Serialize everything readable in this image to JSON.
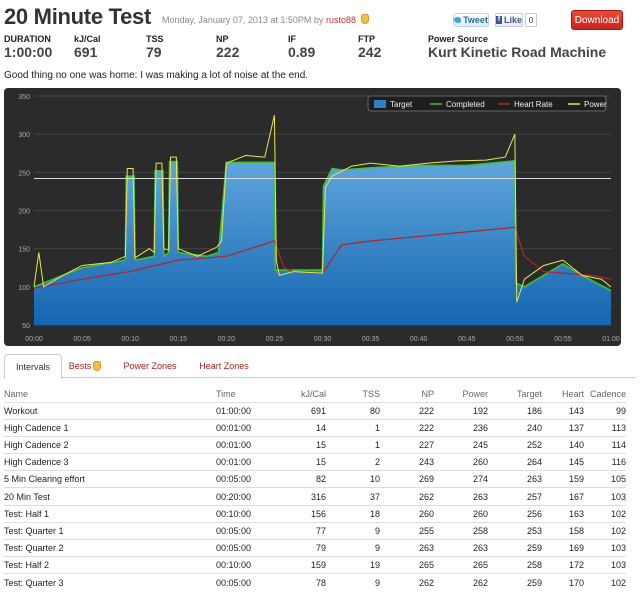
{
  "header": {
    "title": "20 Minute Test",
    "date": "Monday, January 07, 2013 at 1:50PM by",
    "user": "rusto88",
    "tweet_label": "Tweet",
    "like_label": "Like",
    "like_count": "0",
    "download_label": "Download"
  },
  "stats": [
    {
      "label": "DURATION",
      "value": "1:00:00"
    },
    {
      "label": "kJ/Cal",
      "value": "691"
    },
    {
      "label": "TSS",
      "value": "79"
    },
    {
      "label": "NP",
      "value": "222"
    },
    {
      "label": "IF",
      "value": "0.89"
    },
    {
      "label": "FTP",
      "value": "242"
    },
    {
      "label": "Power Source",
      "value": "Kurt Kinetic Road Machine"
    }
  ],
  "description": "Good thing no one was home: I was making a lot of noise at the end.",
  "chart_data": {
    "type": "area",
    "ylim": [
      50,
      350
    ],
    "y_ticks": [
      50,
      100,
      150,
      200,
      250,
      300,
      350
    ],
    "x_ticks": [
      "00:00",
      "00:05",
      "00:10",
      "00:15",
      "00:20",
      "00:25",
      "00:30",
      "00:35",
      "00:40",
      "00:45",
      "00:50",
      "00:55",
      "01:00"
    ],
    "xlim_minutes": [
      0,
      60
    ],
    "ftp_line": 242,
    "legend": [
      "Target",
      "Completed",
      "Heart Rate",
      "Power"
    ],
    "colors": {
      "target": "#2f7fc6",
      "completed": "#3dbf3d",
      "heart_rate": "#b02525",
      "power": "#e8e84a"
    },
    "series": [
      {
        "name": "Target",
        "x": [
          0,
          5,
          9.5,
          9.6,
          10.4,
          10.5,
          12.5,
          12.6,
          13.4,
          13.5,
          14,
          14.1,
          14.9,
          15,
          18,
          19.2,
          20,
          25,
          25.1,
          30,
          30.1,
          31,
          32,
          35,
          40,
          45,
          50,
          50.1,
          51,
          55,
          57,
          60
        ],
        "values": [
          100,
          125,
          135,
          245,
          245,
          135,
          140,
          252,
          252,
          140,
          145,
          264,
          264,
          145,
          140,
          145,
          263,
          263,
          122,
          122,
          232,
          255,
          253,
          256,
          259,
          259,
          265,
          105,
          100,
          130,
          115,
          95
        ]
      },
      {
        "name": "Heart Rate",
        "x": [
          0,
          5,
          10,
          15,
          18,
          20,
          22,
          25,
          26,
          27,
          30,
          32,
          35,
          40,
          45,
          50,
          51,
          53,
          55,
          58,
          60
        ],
        "values": [
          98,
          110,
          120,
          135,
          138,
          140,
          148,
          160,
          125,
          120,
          118,
          155,
          160,
          166,
          172,
          178,
          140,
          120,
          118,
          115,
          110
        ]
      },
      {
        "name": "Power",
        "x": [
          0,
          0.5,
          1,
          3,
          5,
          8,
          9.5,
          9.7,
          10.3,
          10.5,
          12,
          12.5,
          12.7,
          13.3,
          13.5,
          14,
          14.2,
          14.8,
          15,
          17,
          19,
          19.5,
          20,
          22,
          24,
          25,
          25.2,
          25.5,
          27,
          30,
          30.3,
          31,
          33,
          35,
          38,
          41,
          44,
          47,
          49,
          50,
          50.2,
          51,
          53,
          55,
          57,
          59,
          60
        ],
        "values": [
          100,
          145,
          100,
          115,
          128,
          132,
          140,
          255,
          255,
          138,
          150,
          145,
          262,
          262,
          150,
          148,
          270,
          270,
          150,
          140,
          152,
          160,
          262,
          272,
          270,
          325,
          135,
          115,
          120,
          118,
          230,
          245,
          258,
          262,
          258,
          262,
          265,
          266,
          270,
          300,
          80,
          110,
          128,
          135,
          115,
          110,
          100
        ]
      }
    ]
  },
  "tabs": [
    "Intervals",
    "Bests",
    "Power Zones",
    "Heart Zones"
  ],
  "table": {
    "headers": [
      "Name",
      "Time",
      "kJ/Cal",
      "TSS",
      "NP",
      "Power",
      "Target",
      "Heart",
      "Cadence"
    ],
    "rows": [
      [
        "Workout",
        "01:00:00",
        "691",
        "80",
        "222",
        "192",
        "186",
        "143",
        "99"
      ],
      [
        "High Cadence 1",
        "00:01:00",
        "14",
        "1",
        "222",
        "236",
        "240",
        "137",
        "113"
      ],
      [
        "High Cadence 2",
        "00:01:00",
        "15",
        "1",
        "227",
        "245",
        "252",
        "140",
        "114"
      ],
      [
        "High Cadence 3",
        "00:01:00",
        "15",
        "2",
        "243",
        "260",
        "264",
        "145",
        "116"
      ],
      [
        "5 Min Clearing effort",
        "00:05:00",
        "82",
        "10",
        "269",
        "274",
        "263",
        "159",
        "105"
      ],
      [
        "20 Min Test",
        "00:20:00",
        "316",
        "37",
        "262",
        "263",
        "257",
        "167",
        "103"
      ],
      [
        "Test: Half 1",
        "00:10:00",
        "156",
        "18",
        "260",
        "260",
        "256",
        "163",
        "102"
      ],
      [
        "Test: Quarter 1",
        "00:05:00",
        "77",
        "9",
        "255",
        "258",
        "253",
        "158",
        "102"
      ],
      [
        "Test: Quarter 2",
        "00:05:00",
        "79",
        "9",
        "263",
        "263",
        "259",
        "169",
        "103"
      ],
      [
        "Test: Half 2",
        "00:10:00",
        "159",
        "19",
        "265",
        "265",
        "258",
        "172",
        "103"
      ],
      [
        "Test: Quarter 3",
        "00:05:00",
        "78",
        "9",
        "262",
        "262",
        "259",
        "170",
        "102"
      ]
    ]
  }
}
